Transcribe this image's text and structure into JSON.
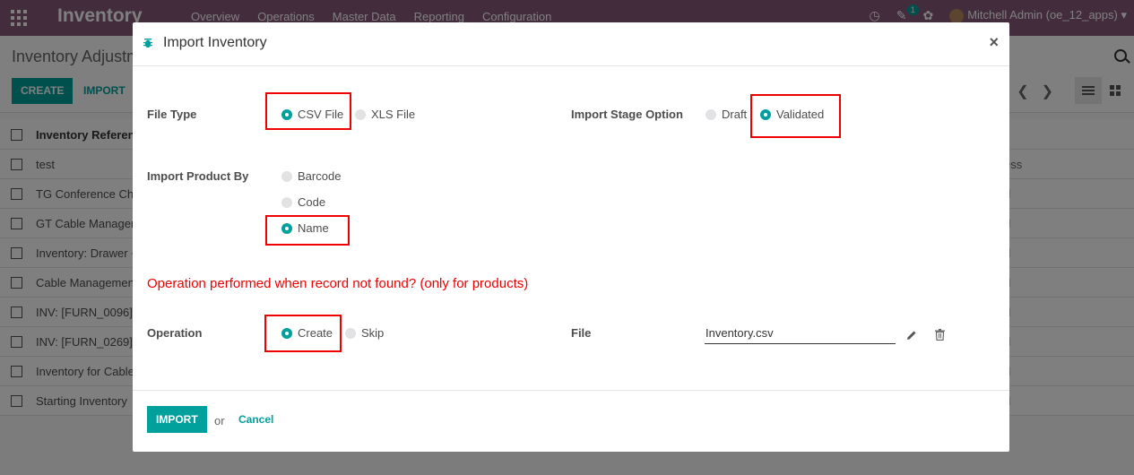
{
  "navbar": {
    "brand": "Inventory",
    "menu": [
      "Overview",
      "Operations",
      "Master Data",
      "Reporting",
      "Configuration"
    ],
    "chat_badge": "1",
    "user": "Mitchell Admin (oe_12_apps)"
  },
  "control": {
    "breadcrumb": "Inventory Adjustm",
    "create_label": "CREATE",
    "import_label": "IMPORT"
  },
  "list": {
    "header": "Inventory Referenc",
    "rows": [
      {
        "name": "test",
        "right": "ess"
      },
      {
        "name": "TG Conference Cha",
        "right": "d"
      },
      {
        "name": "GT Cable Managem",
        "right": "d"
      },
      {
        "name": "Inventory: Drawer +",
        "right": "d"
      },
      {
        "name": "Cable Managemen",
        "right": "d"
      },
      {
        "name": "INV: [FURN_0096] C",
        "right": "d"
      },
      {
        "name": "INV: [FURN_0269] C",
        "right": "d"
      },
      {
        "name": "Inventory for Cable",
        "right": "d"
      },
      {
        "name": "Starting Inventory",
        "right": "d"
      }
    ]
  },
  "modal": {
    "title": "Import Inventory",
    "file_type": {
      "label": "File Type",
      "options": [
        "CSV File",
        "XLS File"
      ],
      "selected": "CSV File"
    },
    "stage": {
      "label": "Import Stage Option",
      "options": [
        "Draft",
        "Validated"
      ],
      "selected": "Validated"
    },
    "product_by": {
      "label": "Import Product By",
      "options": [
        "Barcode",
        "Code",
        "Name"
      ],
      "selected": "Name"
    },
    "warning": "Operation performed when record not found? (only for products)",
    "operation": {
      "label": "Operation",
      "options": [
        "Create",
        "Skip"
      ],
      "selected": "Create"
    },
    "file": {
      "label": "File",
      "value": "Inventory.csv"
    },
    "footer": {
      "import_label": "IMPORT",
      "or": "or",
      "cancel_label": "Cancel"
    }
  },
  "colors": {
    "navbar": "#875a7b",
    "accent": "#00a09d",
    "highlight": "#e00000"
  }
}
